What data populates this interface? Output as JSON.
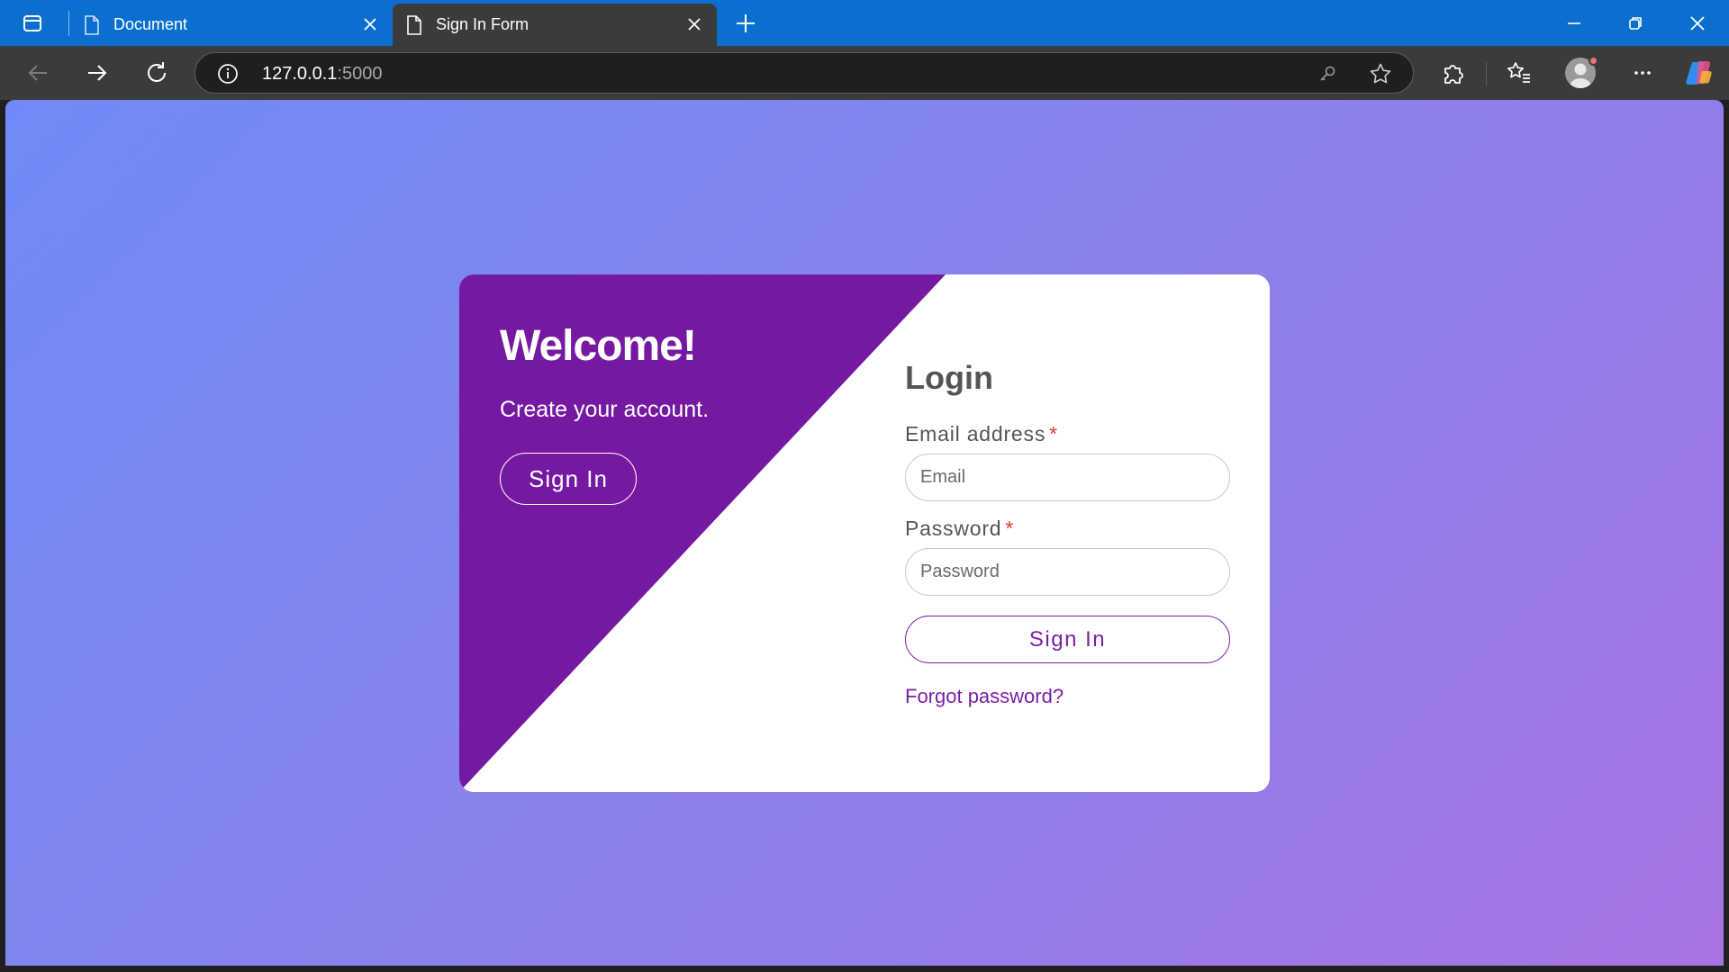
{
  "browser": {
    "tabs": [
      {
        "title": "Document",
        "active": false
      },
      {
        "title": "Sign In Form",
        "active": true
      }
    ],
    "address": {
      "host": "127.0.0.1",
      "port": ":5000"
    },
    "icons": {
      "tab_actions": "tab-actions-icon",
      "new_tab": "plus-icon",
      "minimize": "minimize-icon",
      "restore": "restore-icon",
      "close": "close-icon",
      "back": "back-arrow-icon",
      "forward": "forward-arrow-icon",
      "refresh": "refresh-icon",
      "site_info": "info-icon",
      "password": "key-icon",
      "favorite": "star-icon",
      "extensions": "puzzle-icon",
      "favorites_bar": "favorites-icon",
      "profile": "avatar",
      "menu": "more-icon",
      "copilot": "copilot-icon"
    }
  },
  "page": {
    "welcome": {
      "title": "Welcome!",
      "subtitle": "Create your account.",
      "button": "Sign In"
    },
    "login": {
      "title": "Login",
      "email_label": "Email address",
      "email_placeholder": "Email",
      "password_label": "Password",
      "password_placeholder": "Password",
      "required_marker": "*",
      "submit": "Sign In",
      "forgot": "Forgot password?"
    }
  },
  "colors": {
    "accent": "#7a1fa8",
    "panel": "#7619a2",
    "required": "#e53935",
    "titlebar": "#0a6fcf",
    "gradient_start": "#6f8af7",
    "gradient_end": "#a673e2"
  }
}
